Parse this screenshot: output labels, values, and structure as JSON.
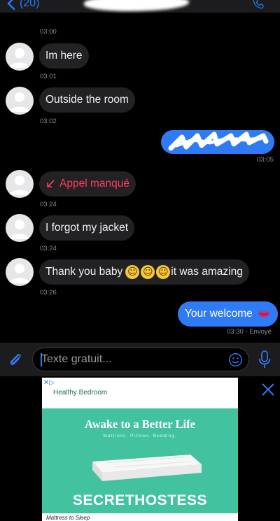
{
  "header": {
    "back_label": "(20)"
  },
  "messages": [
    {
      "id": "ts0",
      "time": "03:00"
    },
    {
      "id": "m1",
      "direction": "in",
      "text": "Im here",
      "time": "03:01"
    },
    {
      "id": "m2",
      "direction": "in",
      "text": "Outside the room",
      "time": "03:02"
    },
    {
      "id": "m3",
      "direction": "out",
      "text": "",
      "time": "03:05"
    },
    {
      "id": "m4",
      "direction": "in",
      "text": "Appel manqué",
      "time": "03:24"
    },
    {
      "id": "m5",
      "direction": "in",
      "text": "I forgot my jacket",
      "time": "03:24"
    },
    {
      "id": "m6",
      "direction": "in",
      "text_before": "Thank you baby",
      "text_after": "it was amazing",
      "time": "03:26"
    },
    {
      "id": "m7",
      "direction": "out",
      "text": "Your welcome",
      "time": "03:30 - Envoyé"
    }
  ],
  "input": {
    "placeholder": "Texte gratuit..."
  },
  "ad": {
    "brand": "Healthy Bedroom",
    "headline": "Awake to a Better Life",
    "tagline": "Mattress. Pillows. Bedding.",
    "watermark": "SECRETHOSTESS",
    "bottom_text": "Mattress to Sleep"
  },
  "colors": {
    "accent": "#2f7bf5",
    "missed_call": "#ff3b5c",
    "ad_green": "#43c2a0"
  },
  "icons": [
    "back-chevron-icon",
    "phone-icon",
    "paperclip-icon",
    "emoji-icon",
    "microphone-icon",
    "close-icon",
    "kiss-icon",
    "missed-call-icon",
    "kissing-face-icon"
  ]
}
